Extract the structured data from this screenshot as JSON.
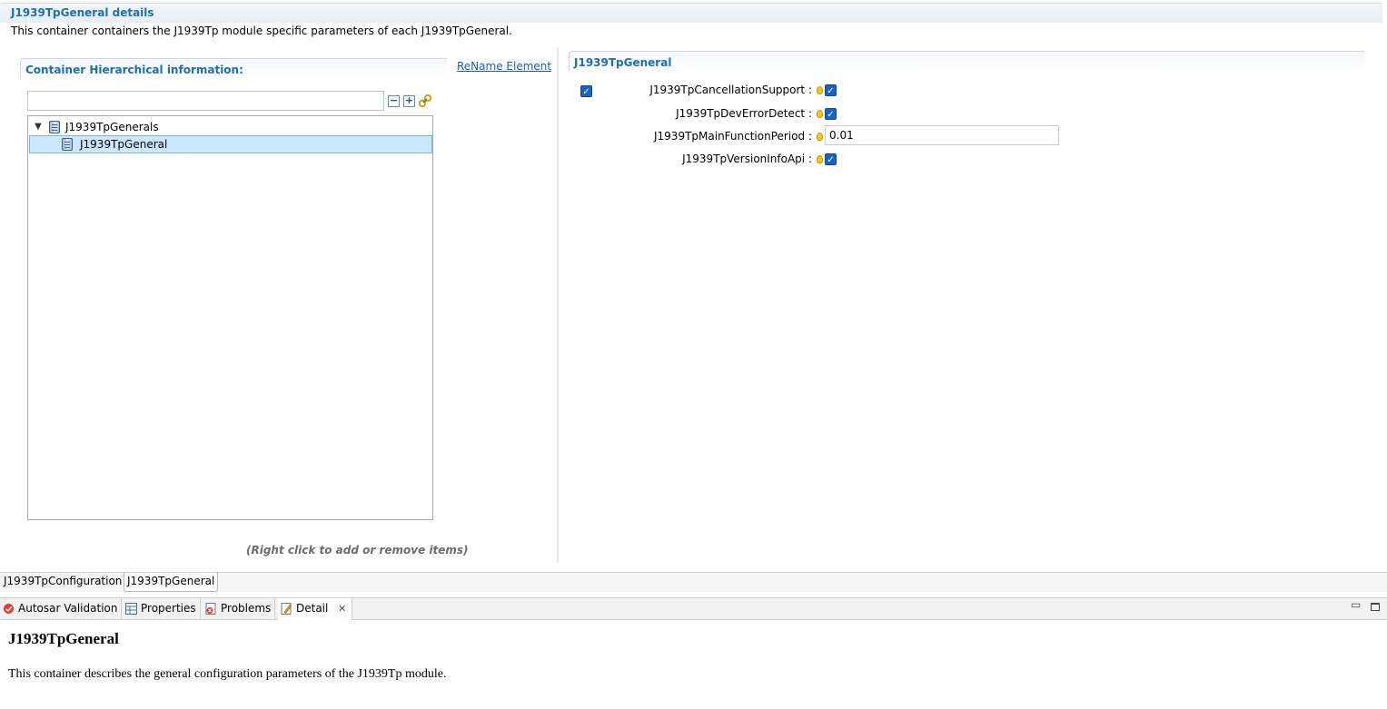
{
  "header": {
    "title": "J1939TpGeneral details",
    "description": "This container containers the J1939Tp module specific parameters of each J1939TpGeneral."
  },
  "hierarchy": {
    "title": "Container Hierarchical information:",
    "rename_link": "ReName Element",
    "filter_value": "",
    "tree": {
      "root_label": "J1939TpGenerals",
      "child_label": "J1939TpGeneral"
    },
    "hint": "(Right click to add or remove items)"
  },
  "general": {
    "title": "J1939TpGeneral",
    "params": [
      {
        "label": "J1939TpCancellationSupport :",
        "type": "checkbox",
        "checked": true
      },
      {
        "label": "J1939TpDevErrorDetect :",
        "type": "checkbox",
        "checked": true
      },
      {
        "label": "J1939TpMainFunctionPeriod :",
        "type": "text",
        "value": "0.01"
      },
      {
        "label": "J1939TpVersionInfoApi :",
        "type": "checkbox",
        "checked": true
      }
    ]
  },
  "editor_tabs": [
    "J1939TpConfiguration",
    "J1939TpGeneral"
  ],
  "view_tabs": [
    "Autosar Validation",
    "Properties",
    "Problems",
    "Detail"
  ],
  "detail": {
    "title": "J1939TpGeneral",
    "description": "This container describes the general configuration parameters of the J1939Tp module."
  },
  "colors": {
    "accent": "#1a6fb8",
    "selection": "#cce8ff",
    "checkbox": "#1565c0"
  }
}
